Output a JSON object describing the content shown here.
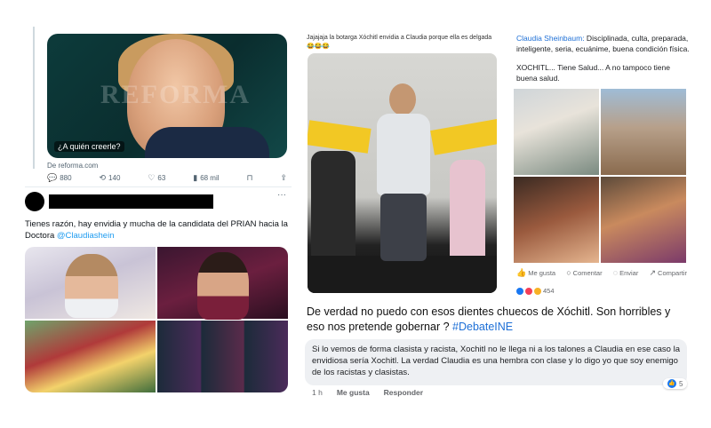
{
  "tweet": {
    "card_caption": "¿A quién creerle?",
    "watermark": "REFORMA",
    "source": "De reforma.com",
    "actions": [
      {
        "icon": "reply-icon",
        "glyph": "💬",
        "count": "880"
      },
      {
        "icon": "retweet-icon",
        "glyph": "⟲",
        "count": "140"
      },
      {
        "icon": "like-icon",
        "glyph": "♡",
        "count": "63"
      },
      {
        "icon": "views-icon",
        "glyph": "▮",
        "count": "68 mil"
      },
      {
        "icon": "bookmark-icon",
        "glyph": "⊓",
        "count": ""
      },
      {
        "icon": "share-icon",
        "glyph": "⇪",
        "count": ""
      }
    ],
    "more": "···",
    "reply_text": "Tienes razón, hay envidia y mucha de la candidata del PRIAN hacia la Doctora",
    "reply_mention": "@Claudiashein"
  },
  "middle_post": {
    "header": "Jajajaja la botarga Xóchitl envidia a Claudia porque ella es delgada 😂😂😂",
    "quote": "De verdad no puedo con esos dientes chuecos de Xóchitl. Son horribles y eso nos pretende gobernar ?",
    "hashtag": "#DebateINE",
    "comment": "Si lo vemos de forma clasista y racista, Xochitl no le llega ni a los talones a Claudia en ese caso la envidiosa sería Xochitl. La verdad Claudia es una hembra con clase y lo digo yo que soy enemigo de los racistas y clasistas.",
    "comment_meta": {
      "time": "1 h",
      "like": "Me gusta",
      "reply": "Responder"
    },
    "reaction_count": "5"
  },
  "right_post": {
    "name": "Claudia Sheinbaum:",
    "line1": " Disciplinada, culta, preparada, inteligente, seria, ecuánime, buena condición física.",
    "line2": "XOCHITL... Tiene Salud... A no tampoco tiene buena salud.",
    "actions": [
      "Me gusta",
      "Comentar",
      "Enviar",
      "Compartir"
    ],
    "reaction_count": "454",
    "colors": {
      "like": "#1877f2",
      "love": "#f33e58",
      "haha": "#f7b125"
    }
  }
}
